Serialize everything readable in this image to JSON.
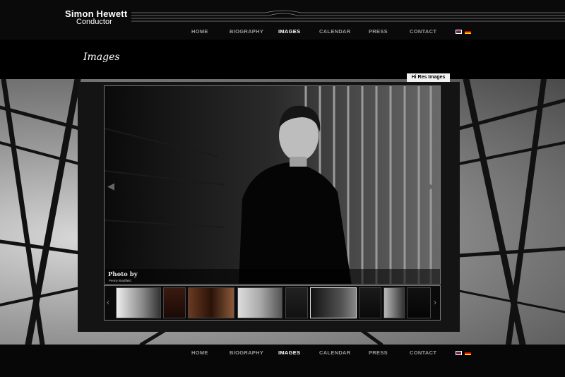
{
  "brand": {
    "name": "Simon Hewett",
    "role": "Conductor"
  },
  "nav": [
    {
      "label": "HOME",
      "active": false
    },
    {
      "label": "BIOGRAPHY",
      "active": false
    },
    {
      "label": "IMAGES",
      "active": true
    },
    {
      "label": "CALENDAR",
      "active": false
    },
    {
      "label": "PRESS",
      "active": false
    },
    {
      "label": "CONTACT",
      "active": false
    }
  ],
  "languages": [
    {
      "icon": "uk-flag-icon"
    },
    {
      "icon": "german-flag-icon"
    }
  ],
  "page": {
    "title": "Images"
  },
  "gallery": {
    "hires_label": "Hi Res Images",
    "caption_title": "Photo by",
    "caption_credit": "Penny Bradfield",
    "prev_icon": "arrow-left-icon",
    "next_icon": "arrow-right-icon",
    "thumb_count": 9,
    "selected_thumb": 6
  },
  "colors": {
    "background": "#000000",
    "panel": "#141414",
    "nav_active": "#ffffff",
    "nav_inactive": "#9a9a9a"
  }
}
